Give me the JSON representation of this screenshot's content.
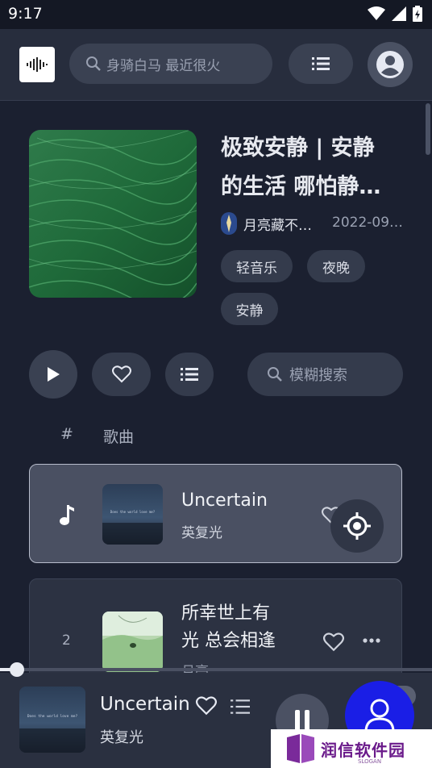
{
  "status_bar": {
    "time": "9:17"
  },
  "header": {
    "search_placeholder": "身骑白马 最近很火",
    "logo_icon": "waveform-icon",
    "menu_icon": "list-icon",
    "profile_icon": "account-circle-icon"
  },
  "playlist": {
    "title_line1": "极致安静 | 安静",
    "title_line2": "的生活 哪怕静…",
    "author": "月亮藏不…",
    "date": "2022-09…",
    "tags": [
      "轻音乐",
      "夜晚",
      "安静"
    ]
  },
  "actions": {
    "search_placeholder": "模糊搜索"
  },
  "columns": {
    "number": "#",
    "song": "歌曲"
  },
  "songs": [
    {
      "number": "",
      "title": "Uncertain",
      "artist": "英复光",
      "cover_text": "Does the world love me?",
      "playing": true
    },
    {
      "number": "2",
      "title_line1": "所幸世上有",
      "title_line2": "光 总会相逢",
      "artist": "月亮"
    }
  ],
  "player": {
    "title": "Uncertain",
    "artist": "英复光",
    "cover_text": "Does the world love me?",
    "progress": 0.04
  },
  "watermark": {
    "text": "润信软件园",
    "slogan": "SLOGAN"
  },
  "colors": {
    "background": "#1b2030",
    "fab": "#1a1ee6",
    "accent_text": "#e6e9f2"
  }
}
